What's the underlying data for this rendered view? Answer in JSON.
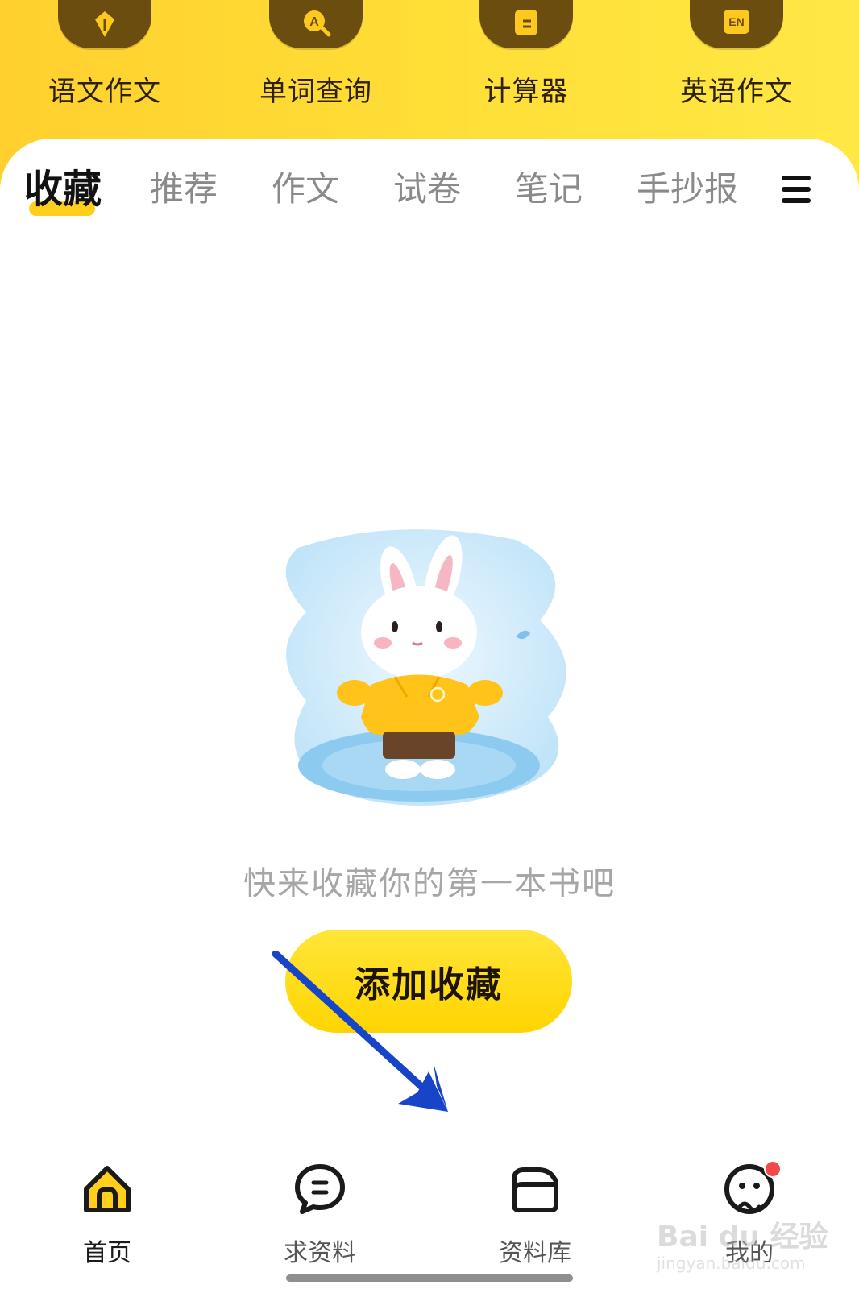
{
  "tools": [
    {
      "label": "语文作文",
      "icon": "pen-nib-icon"
    },
    {
      "label": "单词查询",
      "icon": "word-search-icon"
    },
    {
      "label": "计算器",
      "icon": "calculator-icon"
    },
    {
      "label": "英语作文",
      "icon": "english-essay-icon"
    }
  ],
  "tabs": [
    {
      "label": "收藏",
      "active": true
    },
    {
      "label": "推荐",
      "active": false
    },
    {
      "label": "作文",
      "active": false
    },
    {
      "label": "试卷",
      "active": false
    },
    {
      "label": "笔记",
      "active": false
    },
    {
      "label": "手抄报",
      "active": false
    }
  ],
  "menu_icon": "hamburger-menu-icon",
  "empty_state": {
    "illustration": "bunny-illustration",
    "message": "快来收藏你的第一本书吧",
    "button_label": "添加收藏"
  },
  "annotation_arrow_color": "#1845c8",
  "bottom_nav": [
    {
      "label": "首页",
      "icon": "home-icon",
      "active": true
    },
    {
      "label": "求资料",
      "icon": "chat-bubble-icon",
      "active": false
    },
    {
      "label": "资料库",
      "icon": "folder-icon",
      "active": false
    },
    {
      "label": "我的",
      "icon": "face-icon",
      "active": false,
      "badge": true
    }
  ],
  "watermark": {
    "main": "Bai du 经验",
    "sub": "jingyan.baidu.com"
  },
  "colors": {
    "accent": "#ffd400",
    "header_yellow": "#ffde36",
    "badge_red": "#f24a4a"
  }
}
